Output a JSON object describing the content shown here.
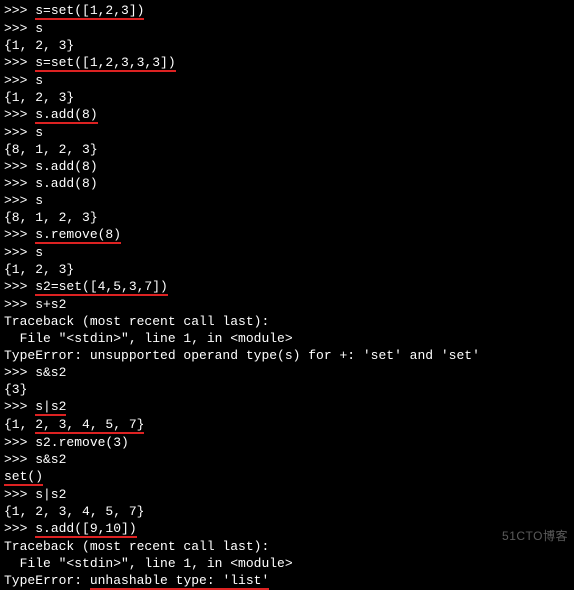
{
  "lines": {
    "l0": ">>> s=set([1,2,3])",
    "l0_u": "s=set([1,2,3])",
    "l1": ">>> s",
    "l2": "{1, 2, 3}",
    "l3": ">>> s=set([1,2,3,3,3])",
    "l3_u": "s=set([1,2,3,3,3])",
    "l4": ">>> s",
    "l5": "{1, 2, 3}",
    "l6": ">>> s.add(8)",
    "l6_u": "s.add(8)",
    "l7": ">>> s",
    "l8": "{8, 1, 2, 3}",
    "l9": ">>> s.add(8)",
    "l10": ">>> s.add(8)",
    "l11": ">>> s",
    "l12": "{8, 1, 2, 3}",
    "l13": ">>> s.remove(8)",
    "l13_u": "s.remove(8)",
    "l14": ">>> s",
    "l15": "{1, 2, 3}",
    "l16": ">>> s2=set([4,5,3,7])",
    "l16_u": "s2=set([4,5,3,7])",
    "l17": ">>> s+s2",
    "l18": "Traceback (most recent call last):",
    "l19": "  File \"<stdin>\", line 1, in <module>",
    "l20": "TypeError: unsupported operand type(s) for +: 'set' and 'set'",
    "l21": ">>> s&s2",
    "l22": "{3}",
    "l23": ">>> s|s2",
    "l23_u": "s|s2",
    "l24": "{1, 2, 3, 4, 5, 7}",
    "l24_u": "2, 3, 4, 5, 7}",
    "l25": ">>> s2.remove(3)",
    "l26": ">>> s&s2",
    "l27": "set()",
    "l28": ">>> s|s2",
    "l29": "{1, 2, 3, 4, 5, 7}",
    "l30": ">>> s.add([9,10])",
    "l30_u": "s.add([9,10])",
    "l31": "Traceback (most recent call last):",
    "l32": "  File \"<stdin>\", line 1, in <module>",
    "l33_a": "TypeError: ",
    "l33_u": "unhashable type: 'list'"
  },
  "watermark": "51CTO博客"
}
